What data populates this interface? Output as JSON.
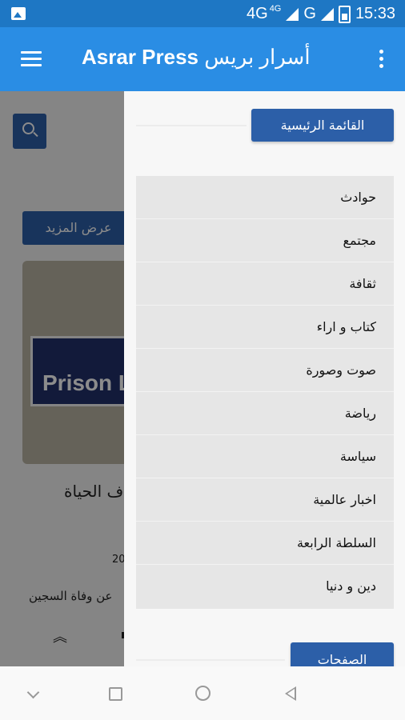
{
  "status_bar": {
    "network_1": "4G",
    "network_1_sup": "4G",
    "network_2": "G",
    "time": "15:33"
  },
  "app_bar": {
    "title_en": "Asrar Press",
    "title_ar": "أسرار بريس"
  },
  "background": {
    "more_button": "عرض المزيد",
    "image_sign_text": "Prison Lo",
    "headline_fragment": "ف الحياة",
    "date_fragment": "20",
    "snippet_fragment": "عن وفاة السجين"
  },
  "drawer": {
    "main_menu_button": "القائمة الرئيسية",
    "pages_button": "الصفحات",
    "menu_items": [
      {
        "label": "حوادث"
      },
      {
        "label": "مجتمع"
      },
      {
        "label": "ثقافة"
      },
      {
        "label": "كتاب و اراء"
      },
      {
        "label": "صوت وصورة"
      },
      {
        "label": "رياضة"
      },
      {
        "label": "سياسة"
      },
      {
        "label": "اخبار عالمية"
      },
      {
        "label": "السلطة الرابعة"
      },
      {
        "label": "دين و دنيا"
      }
    ]
  },
  "icons": {
    "status_left": "image-icon",
    "menu": "hamburger-menu-icon",
    "overflow": "more-vert-icon",
    "search": "search-icon",
    "nav": [
      "nav-collapse-icon",
      "nav-recents-icon",
      "nav-home-icon",
      "nav-back-icon"
    ]
  },
  "colors": {
    "app_bar": "#2a8de4",
    "status_bar": "#1e77c4",
    "button": "#2c5fa8"
  }
}
